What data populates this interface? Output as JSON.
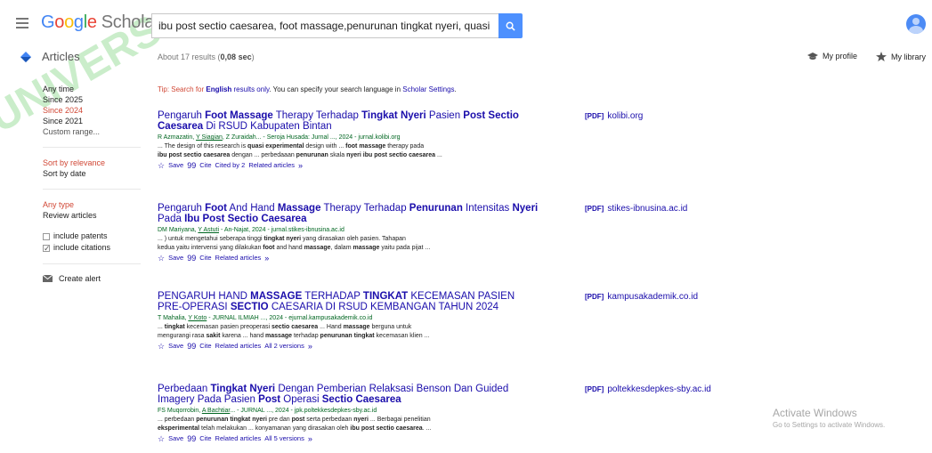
{
  "header": {
    "logo_letters": [
      "G",
      "o",
      "o",
      "g",
      "l",
      "e"
    ],
    "logo_scholar": "Scholar",
    "search_value": "ibu post sectio caesarea, foot massage,penurunan tingkat nyeri, quasi eksperi"
  },
  "subbar": {
    "articles": "Articles",
    "about": "About 17 results (",
    "time": "0,08 sec",
    "close": ")",
    "my_profile": "My profile",
    "my_library": "My library"
  },
  "sidebar": {
    "time_filters": [
      "Any time",
      "Since 2025",
      "Since 2024",
      "Since 2021",
      "Custom range..."
    ],
    "sort": [
      "Sort by relevance",
      "Sort by date"
    ],
    "type": [
      "Any type",
      "Review articles"
    ],
    "include_patents": "include patents",
    "include_citations": "include citations",
    "create_alert": "Create alert"
  },
  "tip": {
    "prefix": "Tip: Search for ",
    "english": "English",
    "mid": " results only",
    "rest": ". You can specify your search language in ",
    "link": "Scholar Settings",
    "end": "."
  },
  "results": [
    {
      "title": [
        [
          "Pengaruh ",
          false
        ],
        [
          "Foot Massage",
          true
        ],
        [
          " Therapy Terhadap ",
          false
        ],
        [
          "Tingkat Nyeri",
          true
        ],
        [
          " Pasien ",
          false
        ],
        [
          "Post Sectio Caesarea",
          true
        ],
        [
          " Di RSUD Kabupaten Bintan",
          false
        ]
      ],
      "meta": [
        [
          "R Azmazatin, ",
          false
        ],
        [
          "Y Siagian",
          true
        ],
        [
          ", Z Zuraidah... - Seroja Husada: Jurnal ..., 2024 - jurnal.kolibi.org",
          false
        ]
      ],
      "snippet1": [
        [
          "... The design of this research is ",
          false
        ],
        [
          "quasi experimental",
          true
        ],
        [
          " design with ... ",
          false
        ],
        [
          "foot massage",
          true
        ],
        [
          " therapy pada",
          false
        ]
      ],
      "snippet2": [
        [
          "ibu post sectio caesarea",
          true
        ],
        [
          " dengan ... perbedaaan ",
          false
        ],
        [
          "penurunan",
          true
        ],
        [
          " skala ",
          false
        ],
        [
          "nyeri ibu post sectio caesarea",
          true
        ],
        [
          " ...",
          false
        ]
      ],
      "actions": [
        "Save",
        "Cite",
        "Cited by 2",
        "Related articles"
      ],
      "pdf_tag": "[PDF]",
      "pdf_source": "kolibi.org"
    },
    {
      "title": [
        [
          "Pengaruh ",
          false
        ],
        [
          "Foot",
          true
        ],
        [
          " And Hand ",
          false
        ],
        [
          "Massage",
          true
        ],
        [
          " Therapy Terhadap ",
          false
        ],
        [
          "Penurunan",
          true
        ],
        [
          " Intensitas ",
          false
        ],
        [
          "Nyeri",
          true
        ],
        [
          " Pada ",
          false
        ],
        [
          "Ibu Post Sectio Caesarea",
          true
        ]
      ],
      "meta": [
        [
          "DM Mariyana, ",
          false
        ],
        [
          "Y Astuti",
          true
        ],
        [
          " - An-Najat, 2024 - jurnal.stikes-ibnusina.ac.id",
          false
        ]
      ],
      "snippet1": [
        [
          "... ) untuk mengetahui seberapa tinggi ",
          false
        ],
        [
          "tingkat nyeri",
          true
        ],
        [
          " yang dirasakan oleh pasien. Tahapan",
          false
        ]
      ],
      "snippet2": [
        [
          "kedua yaitu intervensi yang dilakukan ",
          false
        ],
        [
          "foot",
          true
        ],
        [
          " and hand ",
          false
        ],
        [
          "massage",
          true
        ],
        [
          ", dalam ",
          false
        ],
        [
          "massage",
          true
        ],
        [
          " yaitu pada pijat ...",
          false
        ]
      ],
      "actions": [
        "Save",
        "Cite",
        "Related articles"
      ],
      "pdf_tag": "[PDF]",
      "pdf_source": "stikes-ibnusina.ac.id"
    },
    {
      "title": [
        [
          "PENGARUH HAND ",
          false
        ],
        [
          "MASSAGE",
          true
        ],
        [
          " TERHADAP ",
          false
        ],
        [
          "TINGKAT",
          true
        ],
        [
          " KECEMASAN PASIEN PRE-OPERASI ",
          false
        ],
        [
          "SECTIO",
          true
        ],
        [
          " CAESARIA DI RSUD KEMBANGAN TAHUN 2024",
          false
        ]
      ],
      "meta": [
        [
          "T Mahalia, ",
          false
        ],
        [
          "Y Koto",
          true
        ],
        [
          " - JURNAL ILMIAH ..., 2024 - ejurnal.kampusakademik.co.id",
          false
        ]
      ],
      "snippet1": [
        [
          "... ",
          false
        ],
        [
          "tingkat",
          true
        ],
        [
          " kecemasan pasien preoperasi ",
          false
        ],
        [
          "sectio caesarea",
          true
        ],
        [
          " ... Hand ",
          false
        ],
        [
          "massage",
          true
        ],
        [
          " berguna untuk",
          false
        ]
      ],
      "snippet2": [
        [
          "mengurangi rasa ",
          false
        ],
        [
          "sakit",
          true
        ],
        [
          " karena ... hand ",
          false
        ],
        [
          "massage",
          true
        ],
        [
          " terhadap ",
          false
        ],
        [
          "penurunan tingkat",
          true
        ],
        [
          " kecemasan klien ...",
          false
        ]
      ],
      "actions": [
        "Save",
        "Cite",
        "Related articles",
        "All 2 versions"
      ],
      "pdf_tag": "[PDF]",
      "pdf_source": "kampusakademik.co.id"
    },
    {
      "title": [
        [
          "Perbedaan ",
          false
        ],
        [
          "Tingkat Nyeri",
          true
        ],
        [
          " Dengan Pemberian Relaksasi Benson Dan Guided Imagery Pada Pasien ",
          false
        ],
        [
          "Post",
          true
        ],
        [
          " Operasi ",
          false
        ],
        [
          "Sectio Caesarea",
          true
        ]
      ],
      "meta": [
        [
          "FS Muqorrobin, ",
          false
        ],
        [
          "A Bachtiar",
          true
        ],
        [
          "... - JURNAL ..., 2024 - jpk.poltekkesdepkes-sby.ac.id",
          false
        ]
      ],
      "snippet1": [
        [
          "... perbedaan ",
          false
        ],
        [
          "penurunan tingkat nyeri",
          true
        ],
        [
          " pre dan ",
          false
        ],
        [
          "post",
          true
        ],
        [
          " serta perbedaan ",
          false
        ],
        [
          "nyeri",
          true
        ],
        [
          " ... Berbagai penelitian",
          false
        ]
      ],
      "snippet2": [
        [
          "eksperimental",
          true
        ],
        [
          " telah melakukan ... konyamanan yang dirasakan oleh ",
          false
        ],
        [
          "ibu post sectio caesarea",
          true
        ],
        [
          ". ...",
          false
        ]
      ],
      "actions": [
        "Save",
        "Cite",
        "Related articles",
        "All 5 versions"
      ],
      "pdf_tag": "[PDF]",
      "pdf_source": "poltekkesdepkes-sby.ac.id"
    }
  ],
  "watermark": {
    "line1": "Activate Windows",
    "line2": "Go to Settings to activate Windows.",
    "overlay_text": "UNIVERS"
  },
  "colors": {
    "link": "#1a0dab",
    "meta_green": "#006621",
    "red": "#d14836",
    "search_button": "#4d90fe"
  }
}
